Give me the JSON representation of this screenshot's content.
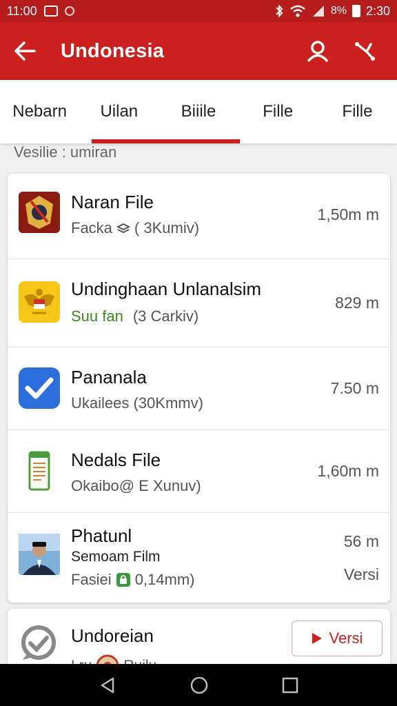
{
  "status_bar": {
    "time_left": "11:00",
    "battery_text": "8%",
    "time_right": "2:30"
  },
  "app_bar": {
    "title": "Undonesia"
  },
  "tabs": [
    {
      "label": "Nebarn"
    },
    {
      "label": "Uilan"
    },
    {
      "label": "Biiile"
    },
    {
      "label": "Fille"
    },
    {
      "label": "Fille"
    }
  ],
  "section": {
    "label": "Vesilie : umiran"
  },
  "files": [
    {
      "name": "Naran File",
      "sub": "Facka",
      "sub_extra": "( 3Kumiv)",
      "size": "1,50m m",
      "icon": "emblem-icon"
    },
    {
      "name": "Undinghaan Unlanalsim",
      "sub": "Suu fan",
      "sub_extra": "(3 Carkiv)",
      "size": "829 m",
      "icon": "garuda-icon"
    },
    {
      "name": "Pananala",
      "sub": "Ukailees (30Kmmv)",
      "size": "7.50 m",
      "icon": "checkmark-icon"
    },
    {
      "name": "Nedals File",
      "sub": "Okaibo@ E Xunuv)",
      "size": "1,60m m",
      "icon": "document-icon"
    },
    {
      "name": "Phatunl",
      "sub_title": "Semoam Film",
      "sub": "Fasiei",
      "sub_extra": "0,14mm)",
      "size": "56 m",
      "action": "Versi",
      "icon": "person-photo-icon"
    }
  ],
  "bottom_item": {
    "name": "Undoreian",
    "sub": "Lru",
    "sub_extra": "Ruilu",
    "button": "Versi",
    "icon": "check-circle-icon"
  },
  "colors": {
    "primary": "#cc1f1f",
    "status_bar": "#b71c1c",
    "accent_green": "#3a8a22"
  }
}
